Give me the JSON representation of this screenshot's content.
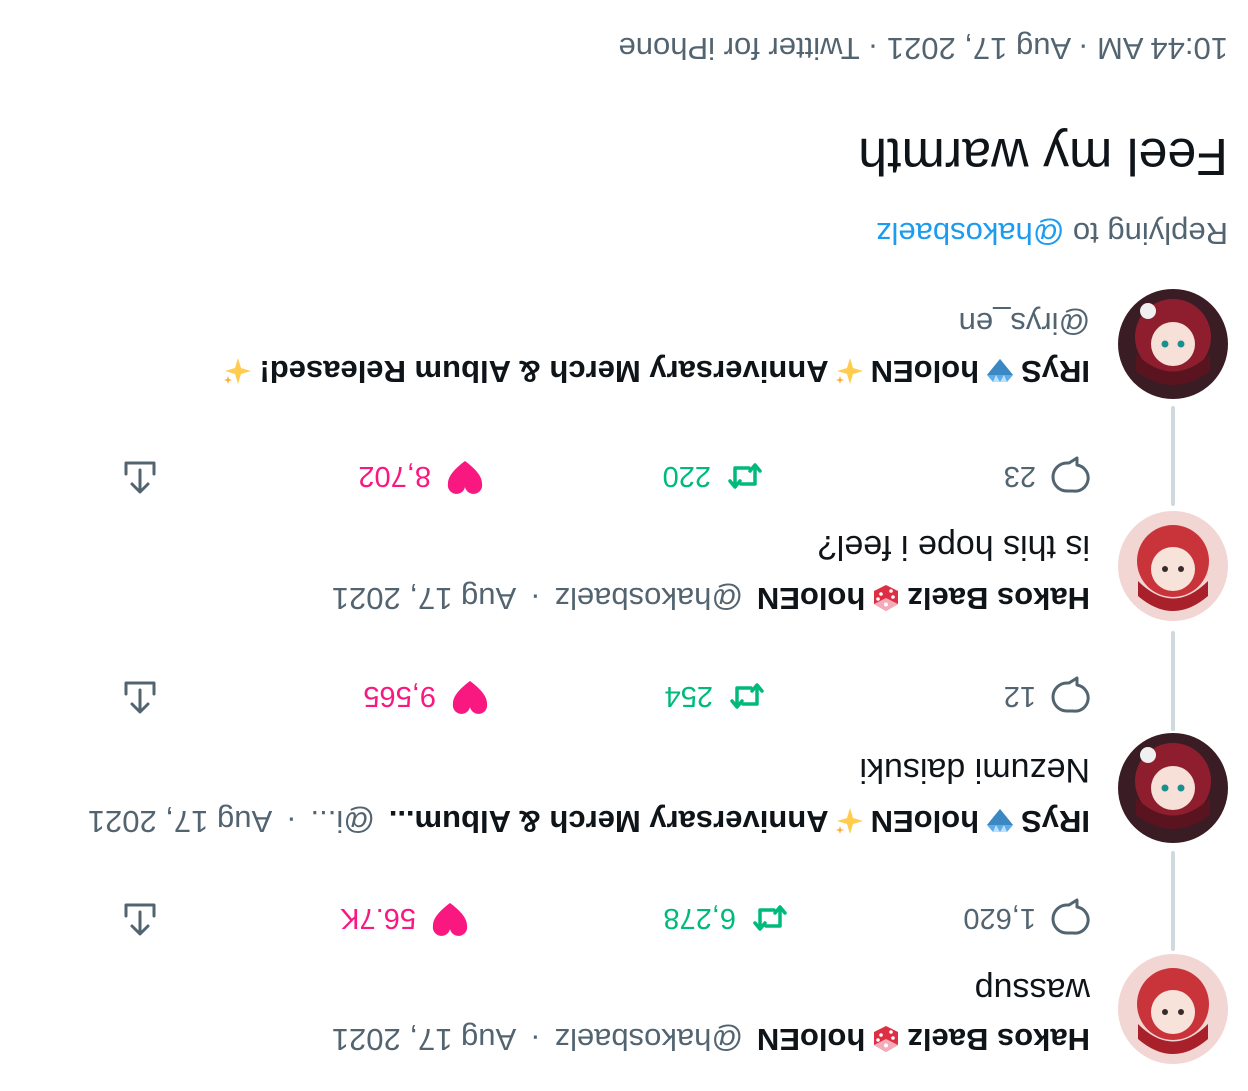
{
  "thread": [
    {
      "author_name": "Hakos Baelz",
      "author_org": "holoEN",
      "author_emoji": "dice-emoji",
      "handle": "@hakosbaelz",
      "date": "Aug 17, 2021",
      "text": "wassup",
      "replies": "1,620",
      "retweets": "6,278",
      "likes": "56.7K"
    },
    {
      "author_name": "IRyS",
      "author_org": "holoEN",
      "author_emoji": "gem-emoji",
      "title_tail": "Anniversary Merch & Album...",
      "handle": "@i...",
      "date": "Aug 17, 2021",
      "text": "Nezumi daisuki",
      "replies": "12",
      "retweets": "254",
      "likes": "9,565"
    },
    {
      "author_name": "Hakos Baelz",
      "author_org": "holoEN",
      "author_emoji": "dice-emoji",
      "handle": "@hakosbaelz",
      "date": "Aug 17, 2021",
      "text": "is this hope i feel?",
      "replies": "23",
      "retweets": "220",
      "likes": "8,702"
    }
  ],
  "main_tweet": {
    "author_name": "IRyS",
    "author_org": "holoEN",
    "title_tail": "Anniversary Merch & Album Released!",
    "handle": "@irys_en",
    "replying_prefix": "Replying to",
    "replying_to": "@hakosbaelz",
    "text": "Feel my warmth",
    "timestamp": "10:44 AM · Aug 17, 2021 · Twitter for iPhone"
  },
  "colors": {
    "reply_gray": "#536471",
    "retweet_green": "#00ba7c",
    "like_pink": "#f91880",
    "link_blue": "#1d9bf0",
    "thread_line": "#cfd9de"
  }
}
